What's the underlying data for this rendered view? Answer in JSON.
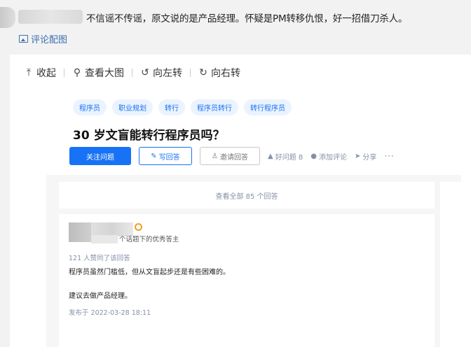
{
  "comment": {
    "text": "不信谣不传谣，原文说的是产品经理。怀疑是PM转移仇恨，好一招借刀杀人。",
    "pic_link": "评论配图"
  },
  "toolbar": {
    "collapse": "收起",
    "view_large": "查看大图",
    "rotate_left": "向左转",
    "rotate_right": "向右转"
  },
  "question": {
    "tags": [
      "程序员",
      "职业规划",
      "转行",
      "程序员转行",
      "转行程序员"
    ],
    "title": "30 岁文盲能转行程序员吗？",
    "follow_label": "关注问题",
    "write_answer_label": "写回答",
    "invite_label": "邀请回答",
    "good_question_label": "好问题 8",
    "add_comment_label": "添加评论",
    "share_label": "分享",
    "more_label": "···"
  },
  "answers_bar": {
    "label": "查看全部 85 个回答"
  },
  "answer": {
    "author_desc": "个话题下的优秀答主",
    "agree_count": "121 人赞同了该回答",
    "para1": "程序员虽然门槛低，但从文盲起步还是有些困难的。",
    "para2": "建议去做产品经理。",
    "date": "发布于 2022-03-28 18:11"
  },
  "colors": {
    "brand_blue": "#1772f6",
    "link_blue": "#3a6fb0",
    "meta_gray": "#8590a6",
    "badge_orange": "#f0a020"
  }
}
